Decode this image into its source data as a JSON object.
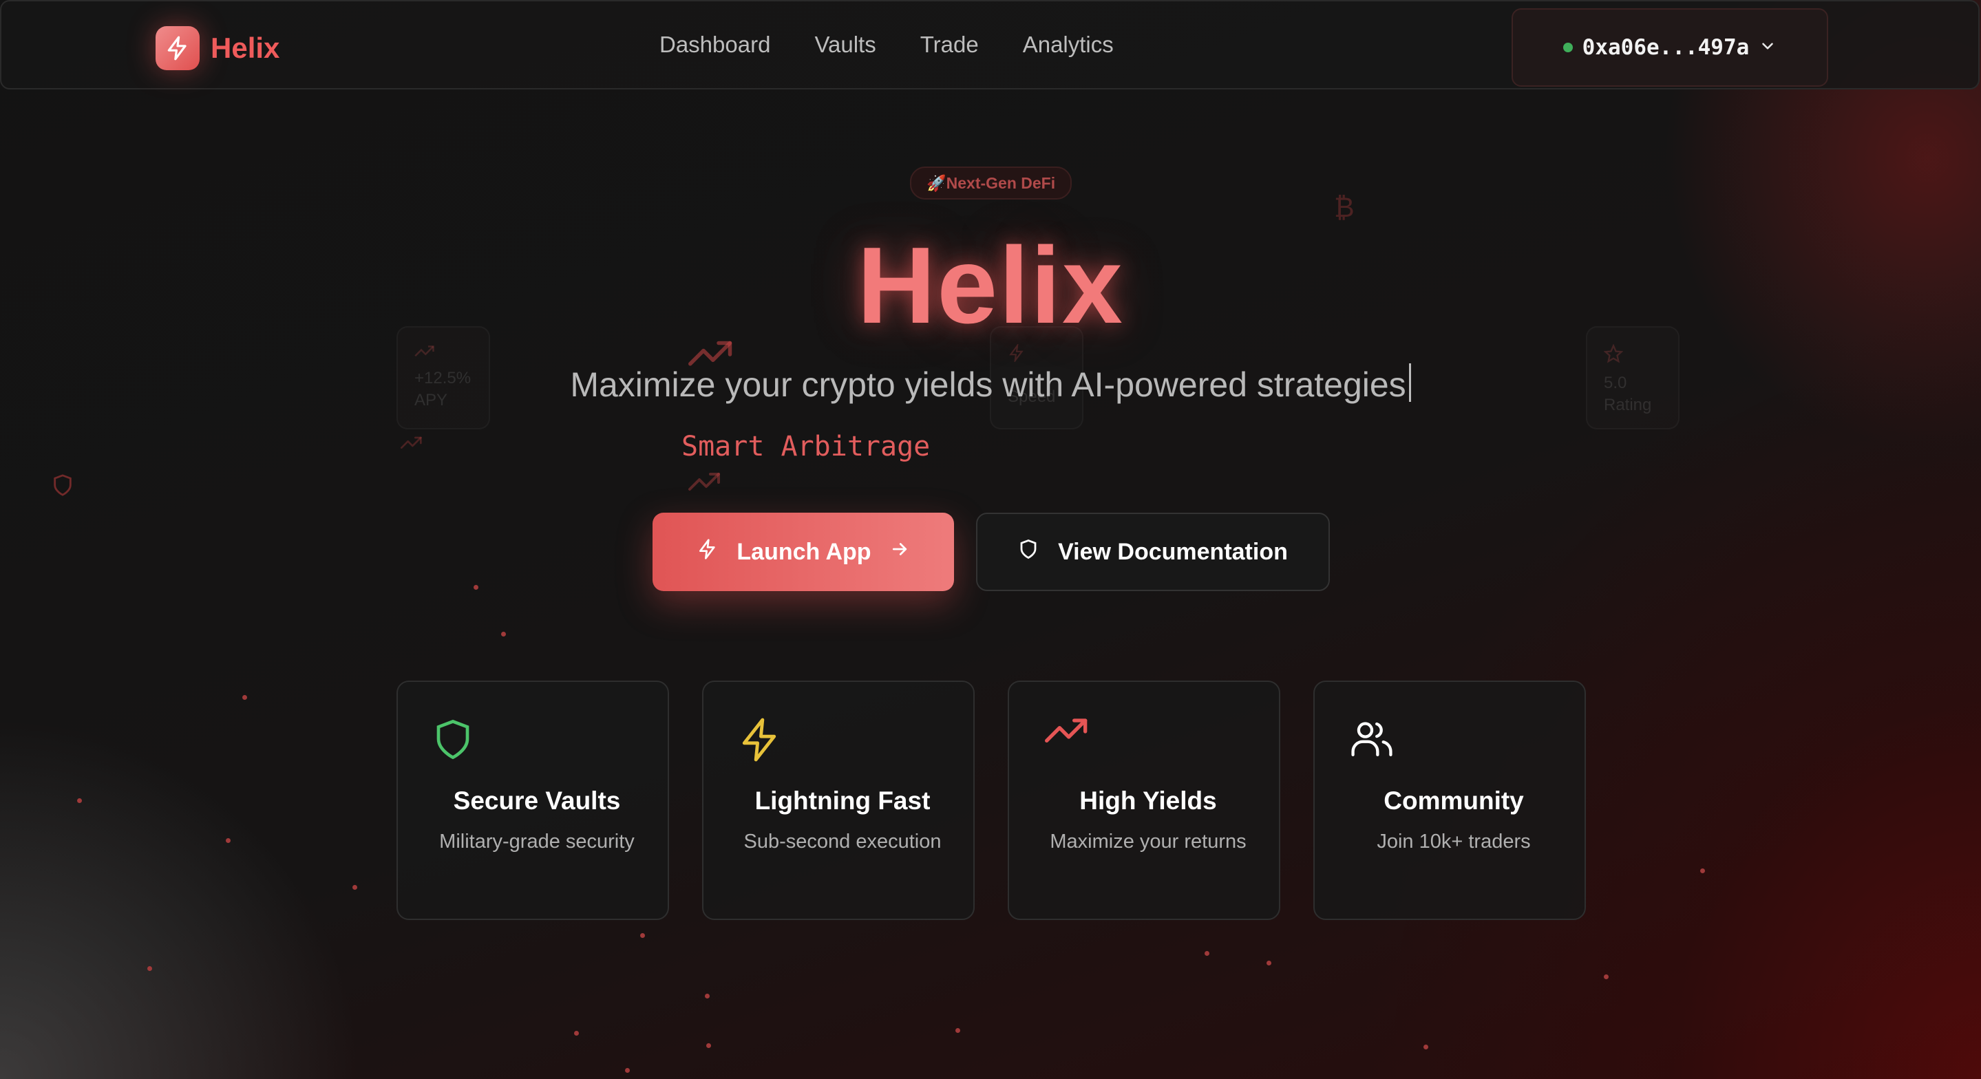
{
  "header": {
    "brand": "Helix",
    "nav": [
      "Dashboard",
      "Vaults",
      "Trade",
      "Analytics"
    ],
    "wallet_address": "0xa06e...497a"
  },
  "hero": {
    "badge": "🚀Next-Gen DeFi",
    "title": "Helix",
    "subtitle": "Maximize your crypto yields with AI-powered strategies",
    "typing_text": "Smart Arbitrage",
    "primary_button": "Launch App",
    "secondary_button": "View Documentation"
  },
  "ghost_stats": [
    {
      "value": "+12.5%",
      "label": "APY",
      "icon": "trending-up-icon"
    },
    {
      "value": "",
      "label": "Speed",
      "icon": "zap-icon"
    },
    {
      "value": "5.0",
      "label": "Rating",
      "icon": "star-icon"
    }
  ],
  "features": [
    {
      "title": "Secure Vaults",
      "desc": "Military-grade security",
      "icon": "shield-icon",
      "color": "#4cc46a"
    },
    {
      "title": "Lightning Fast",
      "desc": "Sub-second execution",
      "icon": "zap-icon",
      "color": "#e8c23a"
    },
    {
      "title": "High Yields",
      "desc": "Maximize your returns",
      "icon": "trending-up-icon",
      "color": "#e55555"
    },
    {
      "title": "Community",
      "desc": "Join 10k+ traders",
      "icon": "users-icon",
      "color": "#ffffff"
    }
  ],
  "colors": {
    "accent": "#ef5b5b",
    "background": "#141414",
    "wallet_status": "#3fae5a"
  }
}
